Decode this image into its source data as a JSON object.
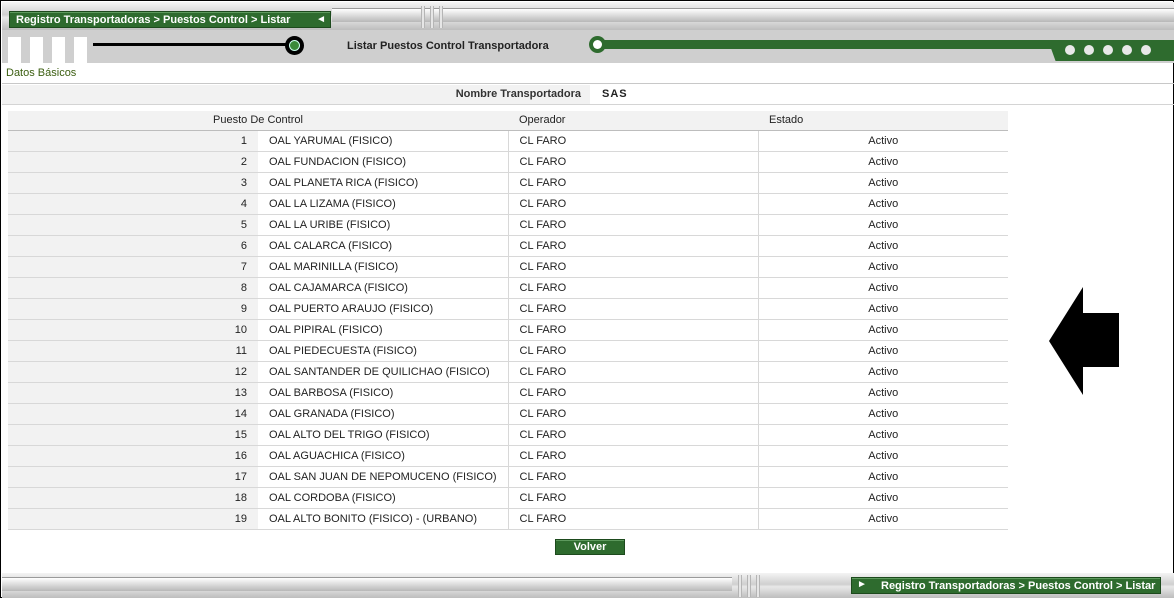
{
  "breadcrumb": {
    "text": "Registro Transportadoras > Puestos Control > Listar",
    "top_arrow": "◄",
    "bottom_arrow": "►"
  },
  "header": {
    "title": "Listar Puestos Control Transportadora"
  },
  "section": {
    "label": "Datos Básicos"
  },
  "transportadora": {
    "label": "Nombre Transportadora",
    "value": "SAS"
  },
  "table": {
    "headers": {
      "puesto": "Puesto De Control",
      "operador": "Operador",
      "estado": "Estado"
    },
    "rows": [
      {
        "num": "1",
        "puesto": "OAL YARUMAL (FISICO)",
        "operador": "CL FARO",
        "estado": "Activo"
      },
      {
        "num": "2",
        "puesto": "OAL FUNDACION (FISICO)",
        "operador": "CL FARO",
        "estado": "Activo"
      },
      {
        "num": "3",
        "puesto": "OAL PLANETA RICA (FISICO)",
        "operador": "CL FARO",
        "estado": "Activo"
      },
      {
        "num": "4",
        "puesto": "OAL LA LIZAMA (FISICO)",
        "operador": "CL FARO",
        "estado": "Activo"
      },
      {
        "num": "5",
        "puesto": "OAL LA URIBE (FISICO)",
        "operador": "CL FARO",
        "estado": "Activo"
      },
      {
        "num": "6",
        "puesto": "OAL CALARCA (FISICO)",
        "operador": "CL FARO",
        "estado": "Activo"
      },
      {
        "num": "7",
        "puesto": "OAL MARINILLA (FISICO)",
        "operador": "CL FARO",
        "estado": "Activo"
      },
      {
        "num": "8",
        "puesto": "OAL CAJAMARCA (FISICO)",
        "operador": "CL FARO",
        "estado": "Activo"
      },
      {
        "num": "9",
        "puesto": "OAL PUERTO ARAUJO (FISICO)",
        "operador": "CL FARO",
        "estado": "Activo"
      },
      {
        "num": "10",
        "puesto": "OAL PIPIRAL (FISICO)",
        "operador": "CL FARO",
        "estado": "Activo"
      },
      {
        "num": "11",
        "puesto": "OAL PIEDECUESTA (FISICO)",
        "operador": "CL FARO",
        "estado": "Activo"
      },
      {
        "num": "12",
        "puesto": "OAL SANTANDER DE QUILICHAO (FISICO)",
        "operador": "CL FARO",
        "estado": "Activo"
      },
      {
        "num": "13",
        "puesto": "OAL BARBOSA (FISICO)",
        "operador": "CL FARO",
        "estado": "Activo"
      },
      {
        "num": "14",
        "puesto": "OAL GRANADA (FISICO)",
        "operador": "CL FARO",
        "estado": "Activo"
      },
      {
        "num": "15",
        "puesto": "OAL ALTO DEL TRIGO (FISICO)",
        "operador": "CL FARO",
        "estado": "Activo"
      },
      {
        "num": "16",
        "puesto": "OAL AGUACHICA (FISICO)",
        "operador": "CL FARO",
        "estado": "Activo"
      },
      {
        "num": "17",
        "puesto": "OAL SAN JUAN DE NEPOMUCENO (FISICO)",
        "operador": "CL FARO",
        "estado": "Activo"
      },
      {
        "num": "18",
        "puesto": "OAL CORDOBA (FISICO)",
        "operador": "CL FARO",
        "estado": "Activo"
      },
      {
        "num": "19",
        "puesto": "OAL ALTO BONITO (FISICO) - (URBANO)",
        "operador": "CL FARO",
        "estado": "Activo"
      }
    ]
  },
  "actions": {
    "volver_label": "Volver"
  },
  "icons": {
    "pointer_arrow": "left-arrow-icon"
  },
  "colors": {
    "brand_green": "#2e6b2e",
    "section_label": "#3b5e10"
  }
}
